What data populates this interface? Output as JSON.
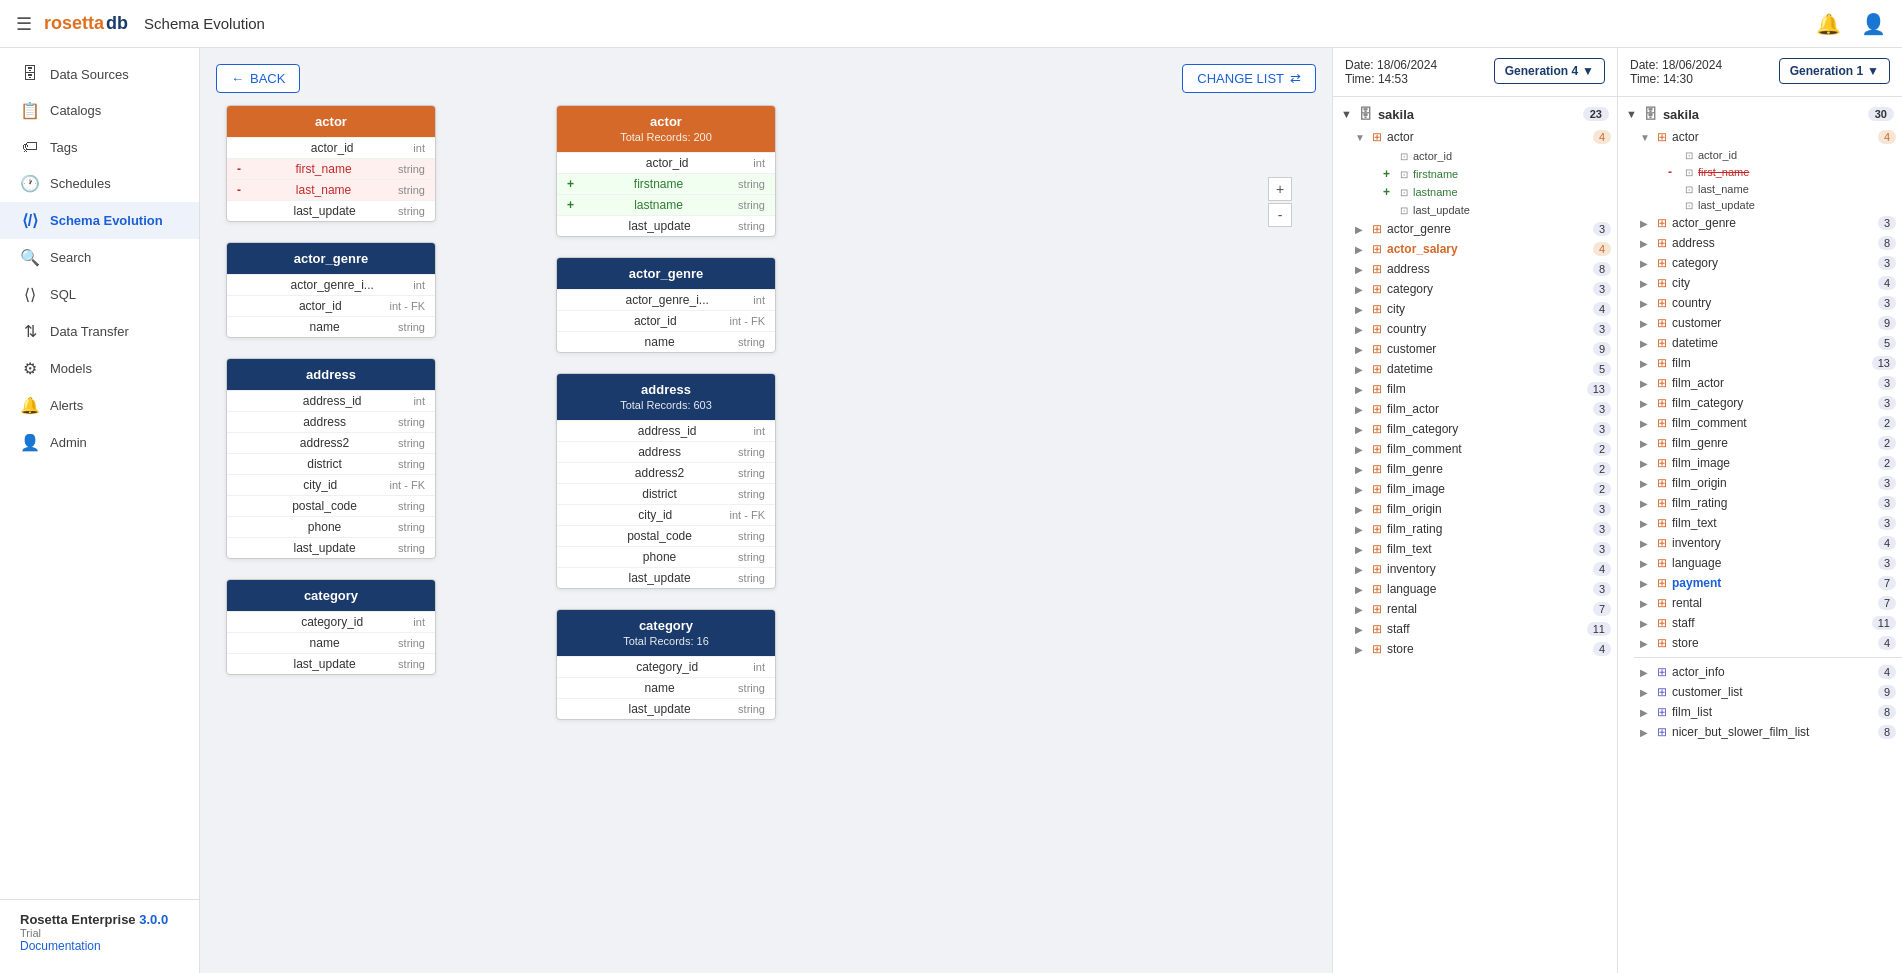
{
  "topnav": {
    "logo_part1": "rosetta",
    "logo_part2": "db",
    "page_title": "Schema Evolution"
  },
  "sidebar": {
    "items": [
      {
        "id": "data-sources",
        "label": "Data Sources",
        "icon": "🗄"
      },
      {
        "id": "catalogs",
        "label": "Catalogs",
        "icon": "📋"
      },
      {
        "id": "tags",
        "label": "Tags",
        "icon": "🏷"
      },
      {
        "id": "schedules",
        "label": "Schedules",
        "icon": "🕐"
      },
      {
        "id": "schema-evolution",
        "label": "Schema Evolution",
        "icon": "⟨/⟩",
        "active": true
      },
      {
        "id": "search",
        "label": "Search",
        "icon": "🔍"
      },
      {
        "id": "sql",
        "label": "SQL",
        "icon": "⟨⟩"
      },
      {
        "id": "data-transfer",
        "label": "Data Transfer",
        "icon": "⇅"
      },
      {
        "id": "models",
        "label": "Models",
        "icon": "⚙"
      },
      {
        "id": "alerts",
        "label": "Alerts",
        "icon": "🔔"
      },
      {
        "id": "admin",
        "label": "Admin",
        "icon": "👤"
      }
    ],
    "version_label": "Rosetta Enterprise",
    "version_number": "3.0.0",
    "trial": "Trial",
    "docs": "Documentation"
  },
  "toolbar": {
    "back_label": "BACK",
    "change_list_label": "CHANGE LIST"
  },
  "left_panel": {
    "date": "Date: 18/06/2024",
    "time": "Time: 14:53",
    "generation": "Generation 4",
    "schema": "sakila",
    "schema_count": 23,
    "tables": [
      {
        "name": "actor",
        "count": 4,
        "expanded": true,
        "fields": [
          {
            "name": "actor_id",
            "marker": ""
          },
          {
            "name": "firstname",
            "marker": "+"
          },
          {
            "name": "lastname",
            "marker": "+"
          },
          {
            "name": "last_update",
            "marker": ""
          }
        ]
      },
      {
        "name": "actor_genre",
        "count": 3
      },
      {
        "name": "actor_salary",
        "count": 4,
        "highlight": true
      },
      {
        "name": "address",
        "count": 8
      },
      {
        "name": "category",
        "count": 3
      },
      {
        "name": "city",
        "count": 4
      },
      {
        "name": "country",
        "count": 3
      },
      {
        "name": "customer",
        "count": 9
      },
      {
        "name": "datetime",
        "count": 5
      },
      {
        "name": "film",
        "count": 13
      },
      {
        "name": "film_actor",
        "count": 3
      },
      {
        "name": "film_category",
        "count": 3
      },
      {
        "name": "film_comment",
        "count": 2
      },
      {
        "name": "film_genre",
        "count": 2
      },
      {
        "name": "film_image",
        "count": 2
      },
      {
        "name": "film_origin",
        "count": 3
      },
      {
        "name": "film_rating",
        "count": 3
      },
      {
        "name": "film_text",
        "count": 3
      },
      {
        "name": "inventory",
        "count": 4
      },
      {
        "name": "language",
        "count": 3
      },
      {
        "name": "rental",
        "count": 7
      },
      {
        "name": "staff",
        "count": 11
      },
      {
        "name": "store",
        "count": 4
      }
    ]
  },
  "right_panel": {
    "date": "Date: 18/06/2024",
    "time": "Time: 14:30",
    "generation": "Generation 1",
    "schema": "sakila",
    "schema_count": 30,
    "tables": [
      {
        "name": "actor",
        "count": 4,
        "expanded": true,
        "fields": [
          {
            "name": "actor_id",
            "marker": ""
          },
          {
            "name": "first_name",
            "marker": "-",
            "removed": true
          },
          {
            "name": "last_name",
            "marker": ""
          },
          {
            "name": "last_update",
            "marker": ""
          }
        ]
      },
      {
        "name": "actor_genre",
        "count": 3
      },
      {
        "name": "address",
        "count": 8
      },
      {
        "name": "category",
        "count": 3
      },
      {
        "name": "city",
        "count": 4
      },
      {
        "name": "country",
        "count": 3
      },
      {
        "name": "customer",
        "count": 9
      },
      {
        "name": "datetime",
        "count": 5
      },
      {
        "name": "film",
        "count": 13
      },
      {
        "name": "film_actor",
        "count": 3
      },
      {
        "name": "film_category",
        "count": 3
      },
      {
        "name": "film_comment",
        "count": 2
      },
      {
        "name": "film_genre",
        "count": 2
      },
      {
        "name": "film_image",
        "count": 2
      },
      {
        "name": "film_origin",
        "count": 3
      },
      {
        "name": "film_rating",
        "count": 3
      },
      {
        "name": "film_text",
        "count": 3
      },
      {
        "name": "inventory",
        "count": 4
      },
      {
        "name": "language",
        "count": 3
      },
      {
        "name": "payment",
        "count": 7,
        "highlight_blue": true
      },
      {
        "name": "rental",
        "count": 7
      },
      {
        "name": "staff",
        "count": 11
      },
      {
        "name": "store",
        "count": 4
      },
      {
        "name": "actor_info",
        "count": 4,
        "view": true
      },
      {
        "name": "customer_list",
        "count": 9,
        "view": true
      },
      {
        "name": "film_list",
        "count": 8,
        "view": true
      },
      {
        "name": "nicer_but_slower_film_list",
        "count": 8,
        "view": true
      }
    ]
  },
  "canvas": {
    "tables_left": [
      {
        "name": "actor",
        "color": "orange",
        "fields": [
          {
            "name": "actor_id",
            "type": "int",
            "marker": ""
          },
          {
            "name": "first_name",
            "type": "string",
            "marker": "-"
          },
          {
            "name": "last_name",
            "type": "string",
            "marker": "-"
          },
          {
            "name": "last_update",
            "type": "string",
            "marker": ""
          }
        ]
      },
      {
        "name": "actor_genre",
        "color": "blue",
        "fields": [
          {
            "name": "actor_genre_i...",
            "type": "int",
            "marker": ""
          },
          {
            "name": "actor_id",
            "type": "int - FK",
            "marker": ""
          },
          {
            "name": "name",
            "type": "string",
            "marker": ""
          }
        ]
      },
      {
        "name": "address",
        "color": "blue",
        "fields": [
          {
            "name": "address_id",
            "type": "int",
            "marker": ""
          },
          {
            "name": "address",
            "type": "string",
            "marker": ""
          },
          {
            "name": "address2",
            "type": "string",
            "marker": ""
          },
          {
            "name": "district",
            "type": "string",
            "marker": ""
          },
          {
            "name": "city_id",
            "type": "int - FK",
            "marker": ""
          },
          {
            "name": "postal_code",
            "type": "string",
            "marker": ""
          },
          {
            "name": "phone",
            "type": "string",
            "marker": ""
          },
          {
            "name": "last_update",
            "type": "string",
            "marker": ""
          }
        ]
      },
      {
        "name": "category",
        "color": "blue",
        "fields": [
          {
            "name": "category_id",
            "type": "int",
            "marker": ""
          },
          {
            "name": "name",
            "type": "string",
            "marker": ""
          },
          {
            "name": "last_update",
            "type": "string",
            "marker": ""
          }
        ]
      }
    ],
    "tables_right": [
      {
        "name": "actor",
        "color": "orange",
        "subtitle": "Total Records: 200",
        "fields": [
          {
            "name": "actor_id",
            "type": "int",
            "marker": ""
          },
          {
            "name": "firstname",
            "type": "string",
            "marker": "+"
          },
          {
            "name": "lastname",
            "type": "string",
            "marker": "+"
          },
          {
            "name": "last_update",
            "type": "string",
            "marker": ""
          }
        ]
      },
      {
        "name": "actor_genre",
        "color": "blue",
        "fields": [
          {
            "name": "actor_genre_i...",
            "type": "int",
            "marker": ""
          },
          {
            "name": "actor_id",
            "type": "int - FK",
            "marker": ""
          },
          {
            "name": "name",
            "type": "string",
            "marker": ""
          }
        ]
      },
      {
        "name": "address",
        "color": "blue",
        "subtitle": "Total Records: 603",
        "fields": [
          {
            "name": "address_id",
            "type": "int",
            "marker": ""
          },
          {
            "name": "address",
            "type": "string",
            "marker": ""
          },
          {
            "name": "address2",
            "type": "string",
            "marker": ""
          },
          {
            "name": "district",
            "type": "string",
            "marker": ""
          },
          {
            "name": "city_id",
            "type": "int - FK",
            "marker": ""
          },
          {
            "name": "postal_code",
            "type": "string",
            "marker": ""
          },
          {
            "name": "phone",
            "type": "string",
            "marker": ""
          },
          {
            "name": "last_update",
            "type": "string",
            "marker": ""
          }
        ]
      },
      {
        "name": "category",
        "color": "blue",
        "subtitle": "Total Records: 16",
        "fields": [
          {
            "name": "category_id",
            "type": "int",
            "marker": ""
          },
          {
            "name": "name",
            "type": "string",
            "marker": ""
          },
          {
            "name": "last_update",
            "type": "string",
            "marker": ""
          }
        ]
      }
    ]
  }
}
